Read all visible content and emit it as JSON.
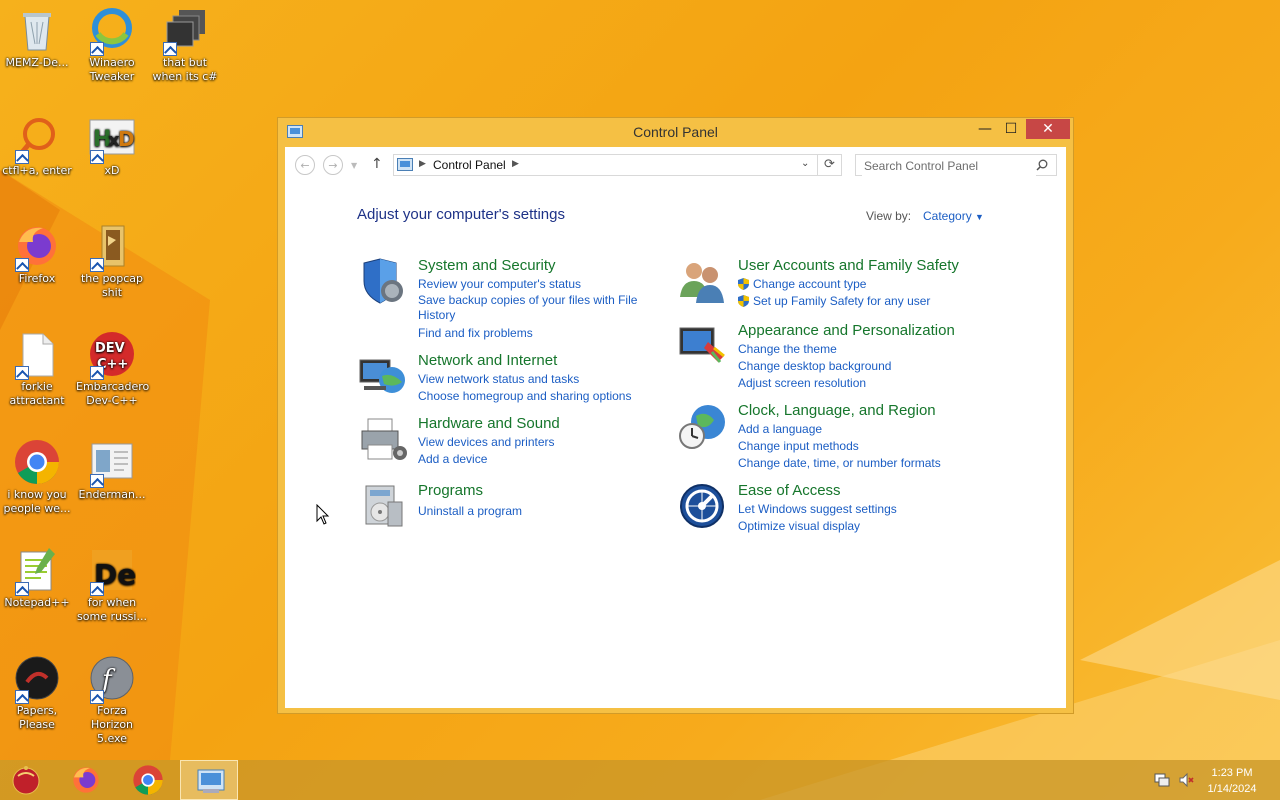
{
  "desktop": {
    "icons": [
      {
        "label": "MEMZ-De...",
        "icon": "recycle-bin-icon"
      },
      {
        "label": "Winaero Tweaker",
        "icon": "winaero-icon"
      },
      {
        "label": "that but when its c#",
        "icon": "stacked-windows-icon"
      },
      {
        "label": "ctfl+a, enter",
        "icon": "magnifier-icon"
      },
      {
        "label": "xD",
        "icon": "hxd-icon"
      },
      {
        "label": "Firefox",
        "icon": "firefox-icon"
      },
      {
        "label": "the popcap shit",
        "icon": "folder-icon"
      },
      {
        "label": "forkie attractant",
        "icon": "blank-file-icon"
      },
      {
        "label": "Embarcadero Dev-C++",
        "icon": "devcpp-icon"
      },
      {
        "label": "i know you people we...",
        "icon": "chrome-icon"
      },
      {
        "label": "Enderman...",
        "icon": "screenshot-file-icon"
      },
      {
        "label": "Notepad++",
        "icon": "notepadpp-icon"
      },
      {
        "label": "for when some russi...",
        "icon": "de-icon"
      },
      {
        "label": "Papers, Please",
        "icon": "papers-please-icon"
      },
      {
        "label": "Forza Horizon 5.exe",
        "icon": "flash-icon"
      }
    ]
  },
  "window": {
    "title": "Control Panel",
    "min_glyph": "—",
    "max_glyph": "☐",
    "close_glyph": "✕"
  },
  "nav": {
    "breadcrumb": "Control Panel",
    "search_placeholder": "Search Control Panel"
  },
  "content": {
    "heading": "Adjust your computer's settings",
    "view_by_label": "View by:",
    "view_by_value": "Category",
    "categories": [
      {
        "title": "System and Security",
        "links": [
          "Review your computer's status",
          "Save backup copies of your files with File History",
          "Find and fix problems"
        ],
        "icon": "shield-icon"
      },
      {
        "title": "Network and Internet",
        "links": [
          "View network status and tasks",
          "Choose homegroup and sharing options"
        ],
        "icon": "network-globe-icon"
      },
      {
        "title": "Hardware and Sound",
        "links": [
          "View devices and printers",
          "Add a device"
        ],
        "icon": "printer-icon"
      },
      {
        "title": "Programs",
        "links": [
          "Uninstall a program"
        ],
        "icon": "programs-icon"
      },
      {
        "title": "User Accounts and Family Safety",
        "links": [
          "Change account type",
          "Set up Family Safety for any user"
        ],
        "icon": "users-icon"
      },
      {
        "title": "Appearance and Personalization",
        "links": [
          "Change the theme",
          "Change desktop background",
          "Adjust screen resolution"
        ],
        "icon": "monitor-paint-icon"
      },
      {
        "title": "Clock, Language, and Region",
        "links": [
          "Add a language",
          "Change input methods",
          "Change date, time, or number formats"
        ],
        "icon": "clock-globe-icon"
      },
      {
        "title": "Ease of Access",
        "links": [
          "Let Windows suggest settings",
          "Optimize visual display"
        ],
        "icon": "ease-of-access-icon"
      }
    ]
  },
  "taskbar": {
    "items": [
      "start-orb-icon",
      "firefox-icon",
      "chrome-icon",
      "control-panel-icon"
    ],
    "time": "1:23 PM",
    "date": "1/14/2024"
  },
  "colors": {
    "category_title": "#16762c",
    "link": "#1c5ec4",
    "heading": "#1e3287",
    "close_button": "#c74745"
  }
}
